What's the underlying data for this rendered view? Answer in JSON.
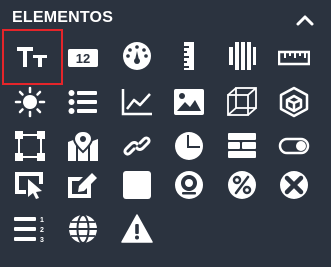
{
  "panel": {
    "title": "ELEMENTOS",
    "collapse_icon": "chevron-up-icon"
  },
  "colors": {
    "background": "#2b333f",
    "icon": "#ffffff",
    "selected_border": "#e5252a"
  },
  "tools": [
    {
      "id": "text",
      "icon": "text-icon",
      "selected": true
    },
    {
      "id": "number",
      "icon": "number-12-icon",
      "label": "12"
    },
    {
      "id": "gauge",
      "icon": "gauge-icon"
    },
    {
      "id": "ruler-vertical",
      "icon": "ruler-vertical-icon"
    },
    {
      "id": "bars",
      "icon": "vertical-bars-icon"
    },
    {
      "id": "ruler-horizontal",
      "icon": "ruler-horizontal-icon"
    },
    {
      "id": "sun",
      "icon": "sun-icon"
    },
    {
      "id": "list",
      "icon": "list-icon"
    },
    {
      "id": "line-chart",
      "icon": "line-chart-icon"
    },
    {
      "id": "image",
      "icon": "image-icon"
    },
    {
      "id": "cube-wireframe",
      "icon": "cube-wireframe-icon"
    },
    {
      "id": "cube-3d",
      "icon": "cube-3d-icon"
    },
    {
      "id": "selection-box",
      "icon": "selection-box-icon"
    },
    {
      "id": "map-pin",
      "icon": "map-pin-icon"
    },
    {
      "id": "link",
      "icon": "link-icon"
    },
    {
      "id": "pie-chart",
      "icon": "pie-chart-icon"
    },
    {
      "id": "brick-wall",
      "icon": "brick-wall-icon"
    },
    {
      "id": "toggle",
      "icon": "toggle-icon"
    },
    {
      "id": "cursor-select",
      "icon": "cursor-select-icon"
    },
    {
      "id": "edit",
      "icon": "edit-icon"
    },
    {
      "id": "square",
      "icon": "square-icon"
    },
    {
      "id": "camera-eye",
      "icon": "camera-eye-icon"
    },
    {
      "id": "percent",
      "icon": "percent-icon"
    },
    {
      "id": "close-circle",
      "icon": "close-circle-icon"
    },
    {
      "id": "numbered-list",
      "icon": "numbered-list-icon",
      "numbers": [
        "1",
        "2",
        "3"
      ]
    },
    {
      "id": "globe",
      "icon": "globe-icon"
    },
    {
      "id": "warning",
      "icon": "warning-icon"
    }
  ]
}
